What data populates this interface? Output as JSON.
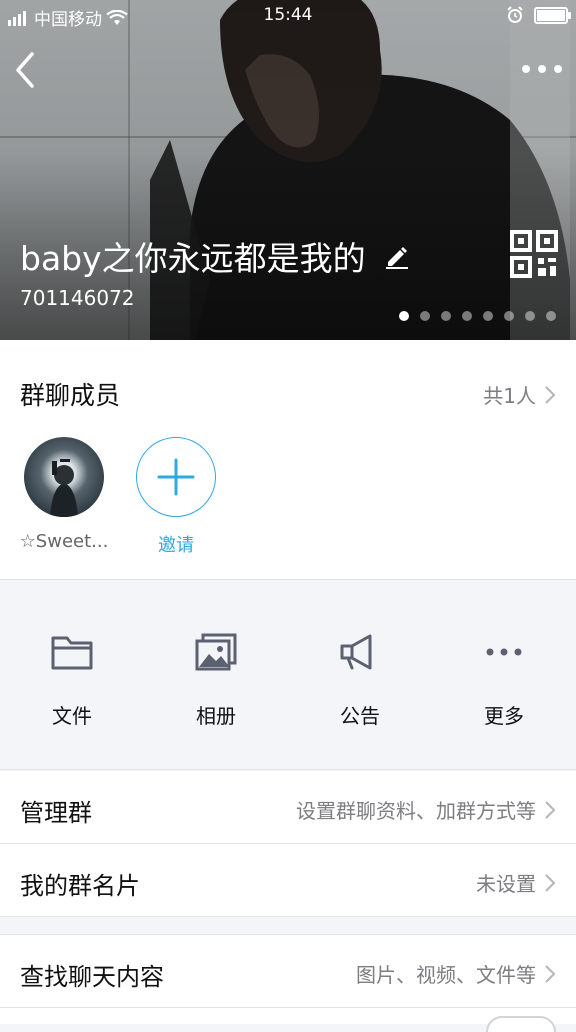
{
  "status": {
    "carrier": "中国移动",
    "time": "15:44"
  },
  "header": {
    "group_name": "baby之你永远都是我的",
    "group_id": "701146072",
    "page_dots": 8,
    "active_dot": 0
  },
  "members": {
    "title": "群聊成员",
    "count": "共1人",
    "list": [
      {
        "name": "☆Sweet..."
      }
    ],
    "invite_label": "邀请"
  },
  "features": [
    {
      "label": "文件",
      "icon": "folder-icon"
    },
    {
      "label": "相册",
      "icon": "photo-album-icon"
    },
    {
      "label": "公告",
      "icon": "megaphone-icon"
    },
    {
      "label": "更多",
      "icon": "more-icon"
    }
  ],
  "rows": [
    {
      "label": "管理群",
      "value": "设置群聊资料、加群方式等"
    },
    {
      "label": "我的群名片",
      "value": "未设置"
    },
    {
      "label": "查找聊天内容",
      "value": "图片、视频、文件等"
    }
  ],
  "colors": {
    "accent": "#2fa9e0",
    "secondary_text": "#7d7d82",
    "icon": "#5b6170"
  }
}
